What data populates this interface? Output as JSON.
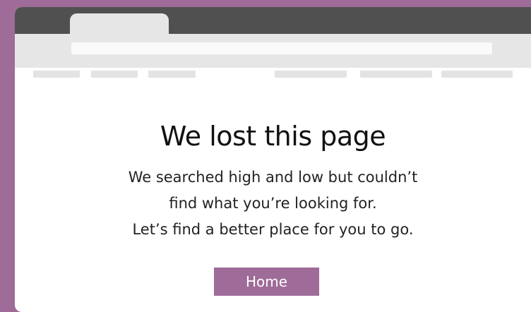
{
  "page": {
    "headline": "We lost this page",
    "message_lines": [
      "We searched high and low but couldn’t",
      "find what you’re looking for.",
      "Let’s find a better place for you to go."
    ],
    "home_button_label": "Home"
  },
  "colors": {
    "page_background": "#9f6b98",
    "browser_topbar": "#505050",
    "address_area": "#e6e6e6",
    "address_bar": "#fafafa",
    "button_background": "#9f6b98",
    "button_text": "#ffffff"
  }
}
